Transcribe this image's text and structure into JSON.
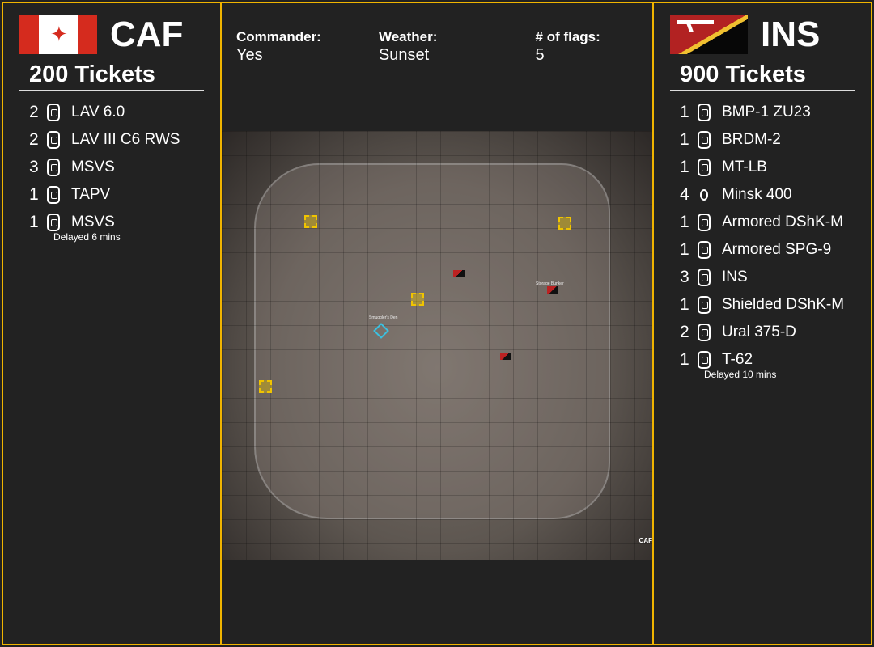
{
  "colors": {
    "border": "#f0b400",
    "background": "#222222",
    "caf_red": "#d52b1e",
    "ins_red": "#b22222",
    "ins_yellow": "#f0c030"
  },
  "left": {
    "team": "CAF",
    "flag_icon": "canada-flag",
    "tickets": "200 Tickets",
    "vehicles": [
      {
        "count": "2",
        "name": "LAV 6.0",
        "icon": "apc-icon"
      },
      {
        "count": "2",
        "name": "LAV III C6 RWS",
        "icon": "ifv-icon"
      },
      {
        "count": "3",
        "name": "MSVS",
        "icon": "logistics-truck-icon"
      },
      {
        "count": "1",
        "name": "TAPV",
        "icon": "mrap-icon"
      },
      {
        "count": "1",
        "name": "MSVS",
        "icon": "transport-truck-icon",
        "note": "Delayed 6 mins"
      }
    ]
  },
  "center": {
    "commander_label": "Commander:",
    "commander": "Yes",
    "weather_label": "Weather:",
    "weather": "Sunset",
    "flags_label": "# of flags:",
    "flags": "5",
    "map": {
      "labels": [
        "Smuggler's Den",
        "Storage Bunker"
      ],
      "corner": "CAF"
    }
  },
  "right": {
    "team": "INS",
    "flag_icon": "insurgent-rifle-flag",
    "tickets": "900 Tickets",
    "vehicles": [
      {
        "count": "1",
        "name": "BMP-1 ZU23",
        "icon": "aa-vehicle-icon"
      },
      {
        "count": "1",
        "name": "BRDM-2",
        "icon": "scout-car-icon"
      },
      {
        "count": "1",
        "name": "MT-LB",
        "icon": "apc-icon"
      },
      {
        "count": "4",
        "name": "Minsk 400",
        "icon": "motorcycle-icon"
      },
      {
        "count": "1",
        "name": "Armored DShK-M",
        "icon": "technical-icon"
      },
      {
        "count": "1",
        "name": "Armored SPG-9",
        "icon": "technical-icon"
      },
      {
        "count": "3",
        "name": "INS",
        "icon": "logistics-truck-icon"
      },
      {
        "count": "1",
        "name": "Shielded DShK-M",
        "icon": "technical-icon"
      },
      {
        "count": "2",
        "name": "Ural 375-D",
        "icon": "transport-truck-icon"
      },
      {
        "count": "1",
        "name": "T-62",
        "icon": "tank-icon",
        "note": "Delayed 10 mins"
      }
    ]
  }
}
